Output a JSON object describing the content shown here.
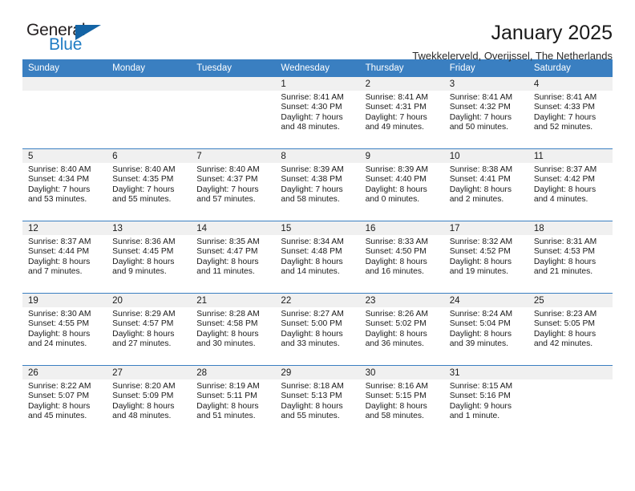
{
  "logo": {
    "word_one": "General",
    "word_two": "Blue",
    "triangle_color": "#1464a5",
    "blue_color": "#1f7cc4"
  },
  "header": {
    "title": "January 2025",
    "subtitle": "Twekkelerveld, Overijssel, The Netherlands",
    "header_bg": "#3a7fc1"
  },
  "calendar": {
    "weekday_headers": [
      "Sunday",
      "Monday",
      "Tuesday",
      "Wednesday",
      "Thursday",
      "Friday",
      "Saturday"
    ],
    "weeks": [
      [
        {
          "day": "",
          "empty": true,
          "sunrise": "",
          "sunset": "",
          "daylight_line1": "",
          "daylight_line2": ""
        },
        {
          "day": "",
          "empty": true,
          "sunrise": "",
          "sunset": "",
          "daylight_line1": "",
          "daylight_line2": ""
        },
        {
          "day": "",
          "empty": true,
          "sunrise": "",
          "sunset": "",
          "daylight_line1": "",
          "daylight_line2": ""
        },
        {
          "day": "1",
          "empty": false,
          "sunrise": "Sunrise: 8:41 AM",
          "sunset": "Sunset: 4:30 PM",
          "daylight_line1": "Daylight: 7 hours",
          "daylight_line2": "and 48 minutes."
        },
        {
          "day": "2",
          "empty": false,
          "sunrise": "Sunrise: 8:41 AM",
          "sunset": "Sunset: 4:31 PM",
          "daylight_line1": "Daylight: 7 hours",
          "daylight_line2": "and 49 minutes."
        },
        {
          "day": "3",
          "empty": false,
          "sunrise": "Sunrise: 8:41 AM",
          "sunset": "Sunset: 4:32 PM",
          "daylight_line1": "Daylight: 7 hours",
          "daylight_line2": "and 50 minutes."
        },
        {
          "day": "4",
          "empty": false,
          "sunrise": "Sunrise: 8:41 AM",
          "sunset": "Sunset: 4:33 PM",
          "daylight_line1": "Daylight: 7 hours",
          "daylight_line2": "and 52 minutes."
        }
      ],
      [
        {
          "day": "5",
          "empty": false,
          "sunrise": "Sunrise: 8:40 AM",
          "sunset": "Sunset: 4:34 PM",
          "daylight_line1": "Daylight: 7 hours",
          "daylight_line2": "and 53 minutes."
        },
        {
          "day": "6",
          "empty": false,
          "sunrise": "Sunrise: 8:40 AM",
          "sunset": "Sunset: 4:35 PM",
          "daylight_line1": "Daylight: 7 hours",
          "daylight_line2": "and 55 minutes."
        },
        {
          "day": "7",
          "empty": false,
          "sunrise": "Sunrise: 8:40 AM",
          "sunset": "Sunset: 4:37 PM",
          "daylight_line1": "Daylight: 7 hours",
          "daylight_line2": "and 57 minutes."
        },
        {
          "day": "8",
          "empty": false,
          "sunrise": "Sunrise: 8:39 AM",
          "sunset": "Sunset: 4:38 PM",
          "daylight_line1": "Daylight: 7 hours",
          "daylight_line2": "and 58 minutes."
        },
        {
          "day": "9",
          "empty": false,
          "sunrise": "Sunrise: 8:39 AM",
          "sunset": "Sunset: 4:40 PM",
          "daylight_line1": "Daylight: 8 hours",
          "daylight_line2": "and 0 minutes."
        },
        {
          "day": "10",
          "empty": false,
          "sunrise": "Sunrise: 8:38 AM",
          "sunset": "Sunset: 4:41 PM",
          "daylight_line1": "Daylight: 8 hours",
          "daylight_line2": "and 2 minutes."
        },
        {
          "day": "11",
          "empty": false,
          "sunrise": "Sunrise: 8:37 AM",
          "sunset": "Sunset: 4:42 PM",
          "daylight_line1": "Daylight: 8 hours",
          "daylight_line2": "and 4 minutes."
        }
      ],
      [
        {
          "day": "12",
          "empty": false,
          "sunrise": "Sunrise: 8:37 AM",
          "sunset": "Sunset: 4:44 PM",
          "daylight_line1": "Daylight: 8 hours",
          "daylight_line2": "and 7 minutes."
        },
        {
          "day": "13",
          "empty": false,
          "sunrise": "Sunrise: 8:36 AM",
          "sunset": "Sunset: 4:45 PM",
          "daylight_line1": "Daylight: 8 hours",
          "daylight_line2": "and 9 minutes."
        },
        {
          "day": "14",
          "empty": false,
          "sunrise": "Sunrise: 8:35 AM",
          "sunset": "Sunset: 4:47 PM",
          "daylight_line1": "Daylight: 8 hours",
          "daylight_line2": "and 11 minutes."
        },
        {
          "day": "15",
          "empty": false,
          "sunrise": "Sunrise: 8:34 AM",
          "sunset": "Sunset: 4:48 PM",
          "daylight_line1": "Daylight: 8 hours",
          "daylight_line2": "and 14 minutes."
        },
        {
          "day": "16",
          "empty": false,
          "sunrise": "Sunrise: 8:33 AM",
          "sunset": "Sunset: 4:50 PM",
          "daylight_line1": "Daylight: 8 hours",
          "daylight_line2": "and 16 minutes."
        },
        {
          "day": "17",
          "empty": false,
          "sunrise": "Sunrise: 8:32 AM",
          "sunset": "Sunset: 4:52 PM",
          "daylight_line1": "Daylight: 8 hours",
          "daylight_line2": "and 19 minutes."
        },
        {
          "day": "18",
          "empty": false,
          "sunrise": "Sunrise: 8:31 AM",
          "sunset": "Sunset: 4:53 PM",
          "daylight_line1": "Daylight: 8 hours",
          "daylight_line2": "and 21 minutes."
        }
      ],
      [
        {
          "day": "19",
          "empty": false,
          "sunrise": "Sunrise: 8:30 AM",
          "sunset": "Sunset: 4:55 PM",
          "daylight_line1": "Daylight: 8 hours",
          "daylight_line2": "and 24 minutes."
        },
        {
          "day": "20",
          "empty": false,
          "sunrise": "Sunrise: 8:29 AM",
          "sunset": "Sunset: 4:57 PM",
          "daylight_line1": "Daylight: 8 hours",
          "daylight_line2": "and 27 minutes."
        },
        {
          "day": "21",
          "empty": false,
          "sunrise": "Sunrise: 8:28 AM",
          "sunset": "Sunset: 4:58 PM",
          "daylight_line1": "Daylight: 8 hours",
          "daylight_line2": "and 30 minutes."
        },
        {
          "day": "22",
          "empty": false,
          "sunrise": "Sunrise: 8:27 AM",
          "sunset": "Sunset: 5:00 PM",
          "daylight_line1": "Daylight: 8 hours",
          "daylight_line2": "and 33 minutes."
        },
        {
          "day": "23",
          "empty": false,
          "sunrise": "Sunrise: 8:26 AM",
          "sunset": "Sunset: 5:02 PM",
          "daylight_line1": "Daylight: 8 hours",
          "daylight_line2": "and 36 minutes."
        },
        {
          "day": "24",
          "empty": false,
          "sunrise": "Sunrise: 8:24 AM",
          "sunset": "Sunset: 5:04 PM",
          "daylight_line1": "Daylight: 8 hours",
          "daylight_line2": "and 39 minutes."
        },
        {
          "day": "25",
          "empty": false,
          "sunrise": "Sunrise: 8:23 AM",
          "sunset": "Sunset: 5:05 PM",
          "daylight_line1": "Daylight: 8 hours",
          "daylight_line2": "and 42 minutes."
        }
      ],
      [
        {
          "day": "26",
          "empty": false,
          "sunrise": "Sunrise: 8:22 AM",
          "sunset": "Sunset: 5:07 PM",
          "daylight_line1": "Daylight: 8 hours",
          "daylight_line2": "and 45 minutes."
        },
        {
          "day": "27",
          "empty": false,
          "sunrise": "Sunrise: 8:20 AM",
          "sunset": "Sunset: 5:09 PM",
          "daylight_line1": "Daylight: 8 hours",
          "daylight_line2": "and 48 minutes."
        },
        {
          "day": "28",
          "empty": false,
          "sunrise": "Sunrise: 8:19 AM",
          "sunset": "Sunset: 5:11 PM",
          "daylight_line1": "Daylight: 8 hours",
          "daylight_line2": "and 51 minutes."
        },
        {
          "day": "29",
          "empty": false,
          "sunrise": "Sunrise: 8:18 AM",
          "sunset": "Sunset: 5:13 PM",
          "daylight_line1": "Daylight: 8 hours",
          "daylight_line2": "and 55 minutes."
        },
        {
          "day": "30",
          "empty": false,
          "sunrise": "Sunrise: 8:16 AM",
          "sunset": "Sunset: 5:15 PM",
          "daylight_line1": "Daylight: 8 hours",
          "daylight_line2": "and 58 minutes."
        },
        {
          "day": "31",
          "empty": false,
          "sunrise": "Sunrise: 8:15 AM",
          "sunset": "Sunset: 5:16 PM",
          "daylight_line1": "Daylight: 9 hours",
          "daylight_line2": "and 1 minute."
        },
        {
          "day": "",
          "empty": true,
          "sunrise": "",
          "sunset": "",
          "daylight_line1": "",
          "daylight_line2": ""
        }
      ]
    ]
  }
}
